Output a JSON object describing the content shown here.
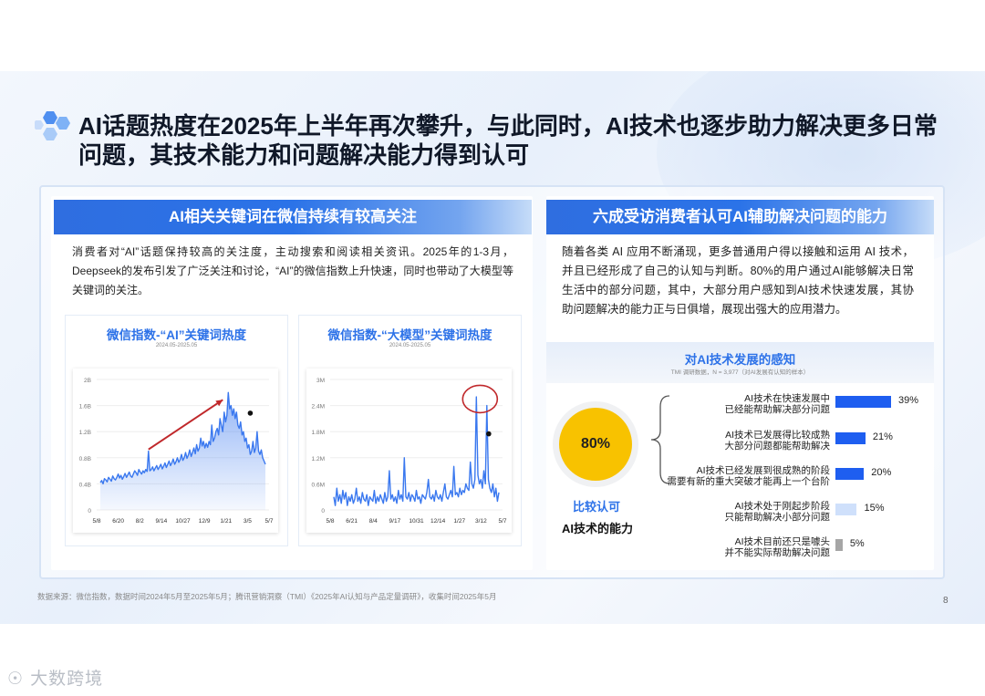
{
  "title": "AI话题热度在2025年上半年再次攀升，与此同时，AI技术也逐步助力解决更多日常问题，其技术能力和问题解决能力得到认可",
  "left": {
    "header": "AI相关关键词在微信持续有较高关注",
    "text": "消费者对“AI”话题保持较高的关注度，主动搜索和阅读相关资讯。2025年的1-3月，Deepseek的发布引发了广泛关注和讨论，“AI”的微信指数上升快速，同时也带动了大模型等关键词的关注。"
  },
  "right": {
    "header": "六成受访消费者认可AI辅助解决问题的能力",
    "text": "随着各类 AI 应用不断涌现，更多普通用户得以接触和运用 AI 技术，并且已经形成了自己的认知与判断。80%的用户通过AI能够解决日常生活中的部分问题，其中，大部分用户感知到AI技术快速发展，其协助问题解决的能力正与日俱增，展现出强大的应用潜力。",
    "circle_value": "80%",
    "circle_label1": "比较认可",
    "circle_label2": "AI技术的能力"
  },
  "footnote": "数据来源：微信指数，数据时间2024年5月至2025年5月；腾讯营销洞察（TMI）《2025年AI认知与产品定量调研》，收集时间2025年5月",
  "page_number": "8",
  "watermark": "大数跨境",
  "colors": {
    "accent": "#2d72e8",
    "line": "#3a78ef",
    "arrow": "#c0282b",
    "highlight": "#f8c200",
    "bar": "#1e5ef0",
    "bar_light": "#cfe0fb",
    "bar_gray": "#a6a6a6"
  },
  "chart_data": [
    {
      "type": "area",
      "title": "微信指数-“AI”关键词热度",
      "subtitle": "2024.05-2025.05",
      "x_ticks": [
        "5/8",
        "6/20",
        "8/2",
        "9/14",
        "10/27",
        "12/9",
        "1/21",
        "3/5",
        "5/7"
      ],
      "y_ticks": [
        "0",
        "0.4B",
        "0.8B",
        "1.2B",
        "1.6B",
        "2B"
      ],
      "ylim": [
        0,
        2.0
      ],
      "unit": "B",
      "series": [
        {
          "values": [
            0.42,
            0.45,
            0.4,
            0.48,
            0.46,
            0.43,
            0.5,
            0.47,
            0.44,
            0.52,
            0.48,
            0.46,
            0.5,
            0.55,
            0.49,
            0.53,
            0.47,
            0.51,
            0.56,
            0.5,
            0.54,
            0.58,
            0.52,
            0.5,
            0.55,
            0.6,
            0.57,
            0.53,
            0.62,
            0.58,
            0.55,
            0.6,
            0.57,
            0.62,
            0.59,
            0.9,
            0.6,
            0.62,
            0.66,
            0.6,
            0.64,
            0.68,
            0.62,
            0.66,
            0.7,
            0.63,
            0.67,
            0.72,
            0.65,
            0.7,
            0.75,
            0.68,
            0.72,
            0.78,
            0.7,
            0.74,
            0.8,
            0.73,
            0.77,
            0.85,
            0.76,
            0.8,
            0.88,
            0.79,
            0.84,
            0.92,
            0.82,
            0.88,
            0.95,
            0.86,
            1.0,
            0.9,
            0.95,
            1.1,
            0.98,
            1.05,
            0.95,
            1.02,
            0.96,
            1.05,
            1.0,
            1.3,
            1.05,
            1.1,
            1.2,
            1.25,
            1.15,
            1.4,
            1.3,
            1.2,
            1.5,
            1.35,
            1.45,
            1.8,
            1.55,
            1.6,
            1.45,
            1.55,
            1.4,
            1.5,
            1.3,
            1.25,
            1.35,
            1.15,
            1.2,
            1.05,
            1.1,
            0.95,
            1.0,
            0.85,
            0.9,
            1.05,
            0.88,
            0.95,
            1.2,
            0.9,
            0.85,
            0.92,
            0.8,
            0.75,
            0.7
          ]
        }
      ],
      "annotation": "arrow"
    },
    {
      "type": "line",
      "title": "微信指数-“大模型”关键词热度",
      "subtitle": "2024.05-2025.05",
      "x_ticks": [
        "5/8",
        "6/21",
        "8/4",
        "9/17",
        "10/31",
        "12/14",
        "1/27",
        "3/12",
        "5/7"
      ],
      "y_ticks": [
        "0",
        "0.6M",
        "1.2M",
        "1.8M",
        "2.4M",
        "3M"
      ],
      "ylim": [
        0,
        3.0
      ],
      "unit": "M",
      "series": [
        {
          "values": [
            0.3,
            0.1,
            0.5,
            0.2,
            0.35,
            0.15,
            0.45,
            0.25,
            0.4,
            0.1,
            0.3,
            0.2,
            0.35,
            0.15,
            0.25,
            0.5,
            0.2,
            0.3,
            0.15,
            0.4,
            0.25,
            0.2,
            0.35,
            0.1,
            0.3,
            0.25,
            0.2,
            0.45,
            0.15,
            0.3,
            0.2,
            0.35,
            0.25,
            0.15,
            0.4,
            0.2,
            0.3,
            0.9,
            0.25,
            0.35,
            0.2,
            0.3,
            0.15,
            0.45,
            0.25,
            0.35,
            0.2,
            1.2,
            0.3,
            0.25,
            0.4,
            0.2,
            0.35,
            0.3,
            0.2,
            0.45,
            0.25,
            0.3,
            0.15,
            0.35,
            0.3,
            0.25,
            0.4,
            0.7,
            0.3,
            0.25,
            0.35,
            0.2,
            0.45,
            0.3,
            0.25,
            0.35,
            0.2,
            0.4,
            0.6,
            0.3,
            0.25,
            0.35,
            0.45,
            0.3,
            1.0,
            0.35,
            0.4,
            0.3,
            0.5,
            0.35,
            0.45,
            0.4,
            0.6,
            0.5,
            0.45,
            1.1,
            0.6,
            0.5,
            0.7,
            2.6,
            0.8,
            0.6,
            0.7,
            0.5,
            0.9,
            0.6,
            2.4,
            0.7,
            0.5,
            0.4,
            0.6,
            0.3,
            0.5,
            0.2,
            0.4
          ]
        }
      ],
      "annotation": "circle"
    },
    {
      "type": "bar",
      "title": "对AI技术发展的感知",
      "subtitle": "TMI 调研数据，N = 3,977（对AI发展有认知的样本）",
      "categories": [
        "AI技术在快速发展中\n已经能帮助解决部分问题",
        "AI技术已发展得比较成熟\n大部分问题都能帮助解决",
        "AI技术已经发展到很成熟的阶段\n需要有新的重大突破才能再上一个台阶",
        "AI技术处于刚起步阶段\n只能帮助解决小部分问题",
        "AI技术目前还只是噱头\n并不能实际帮助解决问题"
      ],
      "values": [
        39,
        21,
        20,
        15,
        5
      ],
      "labels": [
        "39%",
        "21%",
        "20%",
        "15%",
        "5%"
      ],
      "xlim": [
        0,
        100
      ]
    }
  ]
}
